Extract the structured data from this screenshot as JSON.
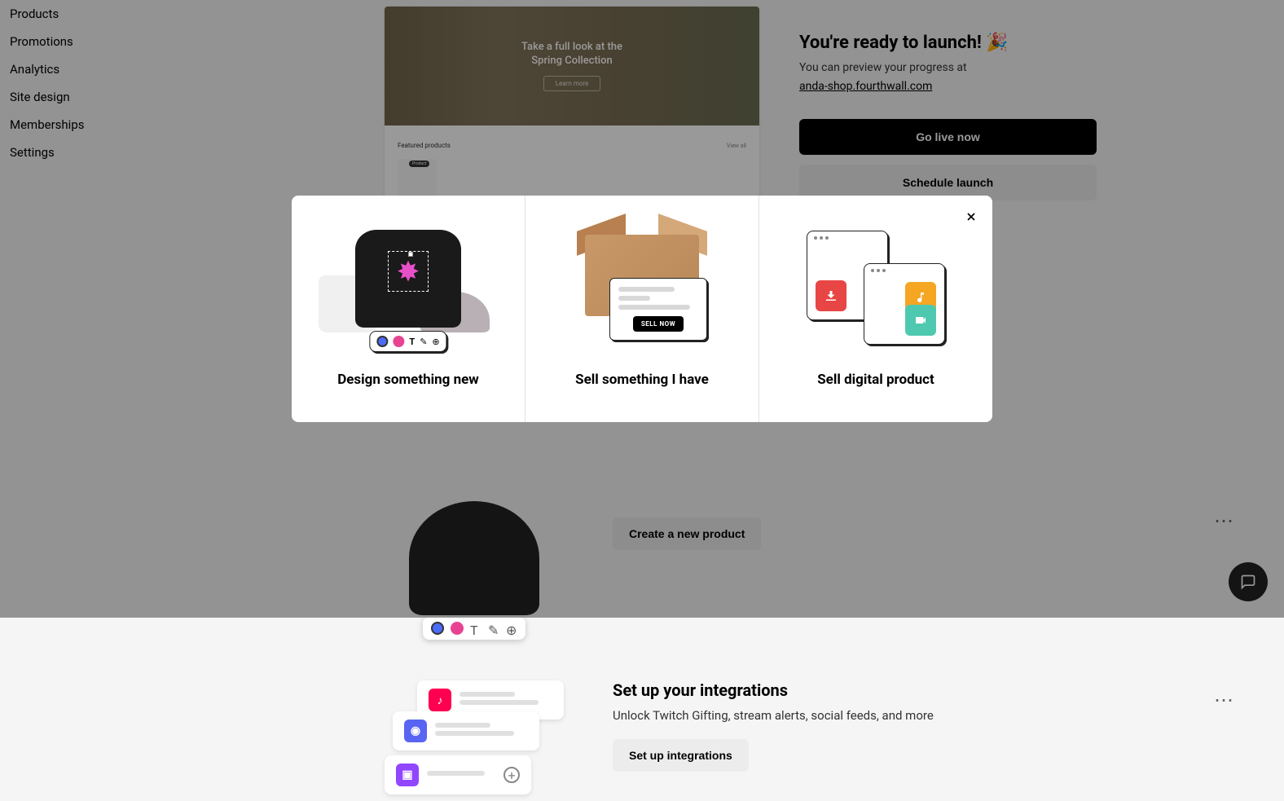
{
  "sidebar": {
    "items": [
      {
        "label": "Products"
      },
      {
        "label": "Promotions"
      },
      {
        "label": "Analytics"
      },
      {
        "label": "Site design"
      },
      {
        "label": "Memberships"
      },
      {
        "label": "Settings"
      }
    ]
  },
  "preview": {
    "hero_line1": "Take a full look at the",
    "hero_line2": "Spring Collection",
    "hero_button": "Learn more",
    "featured_title": "Featured products",
    "featured_view_all": "View all",
    "product_label": "Product"
  },
  "launch": {
    "title": "You're ready to launch! 🎉",
    "subtitle": "You can preview your progress at",
    "url": "anda-shop.fourthwall.com",
    "go_live": "Go live now",
    "schedule": "Schedule launch"
  },
  "create_product": {
    "button": "Create a new product"
  },
  "integrations": {
    "title": "Set up your integrations",
    "subtitle": "Unlock Twitch Gifting, stream alerts, social feeds, and more",
    "button": "Set up integrations"
  },
  "modal": {
    "option1": "Design something new",
    "option2": "Sell something I have",
    "option3": "Sell digital product",
    "sell_now": "SELL NOW"
  }
}
